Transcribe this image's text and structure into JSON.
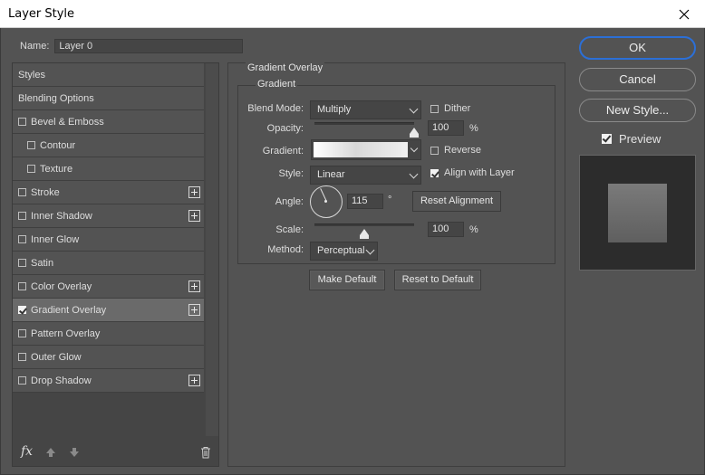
{
  "window": {
    "title": "Layer Style",
    "close_icon": "close-icon"
  },
  "name_field": {
    "label": "Name:",
    "value": "Layer 0"
  },
  "styles_list": {
    "items": [
      {
        "label": "Styles",
        "checkbox": false,
        "checked": false,
        "indent": false,
        "plus": false,
        "selected": false
      },
      {
        "label": "Blending Options",
        "checkbox": false,
        "checked": false,
        "indent": false,
        "plus": false,
        "selected": false
      },
      {
        "label": "Bevel & Emboss",
        "checkbox": true,
        "checked": false,
        "indent": false,
        "plus": false,
        "selected": false
      },
      {
        "label": "Contour",
        "checkbox": true,
        "checked": false,
        "indent": true,
        "plus": false,
        "selected": false
      },
      {
        "label": "Texture",
        "checkbox": true,
        "checked": false,
        "indent": true,
        "plus": false,
        "selected": false
      },
      {
        "label": "Stroke",
        "checkbox": true,
        "checked": false,
        "indent": false,
        "plus": true,
        "selected": false
      },
      {
        "label": "Inner Shadow",
        "checkbox": true,
        "checked": false,
        "indent": false,
        "plus": true,
        "selected": false
      },
      {
        "label": "Inner Glow",
        "checkbox": true,
        "checked": false,
        "indent": false,
        "plus": false,
        "selected": false
      },
      {
        "label": "Satin",
        "checkbox": true,
        "checked": false,
        "indent": false,
        "plus": false,
        "selected": false
      },
      {
        "label": "Color Overlay",
        "checkbox": true,
        "checked": false,
        "indent": false,
        "plus": true,
        "selected": false
      },
      {
        "label": "Gradient Overlay",
        "checkbox": true,
        "checked": true,
        "indent": false,
        "plus": true,
        "selected": true
      },
      {
        "label": "Pattern Overlay",
        "checkbox": true,
        "checked": false,
        "indent": false,
        "plus": false,
        "selected": false
      },
      {
        "label": "Outer Glow",
        "checkbox": true,
        "checked": false,
        "indent": false,
        "plus": false,
        "selected": false
      },
      {
        "label": "Drop Shadow",
        "checkbox": true,
        "checked": false,
        "indent": false,
        "plus": true,
        "selected": false
      }
    ],
    "footer": {
      "fx_label": "fx"
    }
  },
  "gradient_overlay": {
    "section_title": "Gradient Overlay",
    "group_title": "Gradient",
    "blend_mode": {
      "label": "Blend Mode:",
      "value": "Multiply"
    },
    "dither": {
      "label": "Dither",
      "checked": false
    },
    "opacity": {
      "label": "Opacity:",
      "value": "100",
      "unit": "%",
      "slider_fraction": 1.0
    },
    "gradient": {
      "label": "Gradient:"
    },
    "reverse": {
      "label": "Reverse",
      "checked": false
    },
    "style": {
      "label": "Style:",
      "value": "Linear"
    },
    "align_with_layer": {
      "label": "Align with Layer",
      "checked": true
    },
    "angle": {
      "label": "Angle:",
      "value": "115",
      "unit": "°",
      "degrees": 115
    },
    "reset_alignment": {
      "label": "Reset Alignment"
    },
    "scale": {
      "label": "Scale:",
      "value": "100",
      "unit": "%",
      "slider_fraction": 0.5
    },
    "method": {
      "label": "Method:",
      "value": "Perceptual"
    },
    "make_default": {
      "label": "Make Default"
    },
    "reset_to_default": {
      "label": "Reset to Default"
    }
  },
  "side": {
    "ok": "OK",
    "cancel": "Cancel",
    "new_style": "New Style...",
    "preview": {
      "label": "Preview",
      "checked": true
    }
  },
  "colors": {
    "accent": "#2c6fd6",
    "background": "#535353",
    "panel": "#454545"
  }
}
